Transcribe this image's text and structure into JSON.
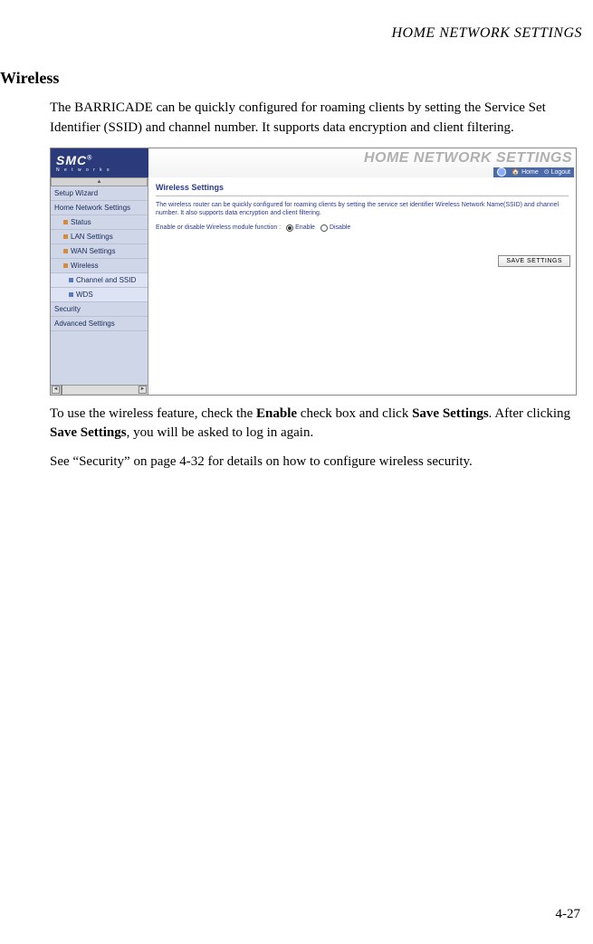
{
  "header": "HOME NETWORK SETTINGS",
  "section_title": "Wireless",
  "intro_text": "The BARRICADE can be quickly configured for roaming clients by setting the Service Set Identifier (SSID) and channel number. It supports data encryption and client filtering.",
  "followup_prefix": "To use the wireless feature, check the ",
  "followup_bold1": "Enable",
  "followup_mid1": " check box and click ",
  "followup_bold2": "Save Settings",
  "followup_mid2": ". After clicking ",
  "followup_bold3": "Save Settings",
  "followup_suffix": ", you will be asked to log in again.",
  "see_text": "See “Security” on page 4-32 for details on how to configure wireless security.",
  "page_number": "4-27",
  "app": {
    "logo_main": "SMC",
    "logo_sub": "N e t w o r k s",
    "title_banner": "HOME NETWORK SETTINGS",
    "topnav_home": "Home",
    "topnav_logout": "Logout",
    "sidebar": {
      "setup_wizard": "Setup Wizard",
      "home_network": "Home Network Settings",
      "status": "Status",
      "lan": "LAN Settings",
      "wan": "WAN Settings",
      "wireless": "Wireless",
      "channel_ssid": "Channel and SSID",
      "wds": "WDS",
      "security": "Security",
      "advanced": "Advanced Settings"
    },
    "panel": {
      "title": "Wireless Settings",
      "desc": "The wireless router can be quickly configured for roaming clients by setting the service set identifier Wireless Network Name(SSID) and channel number. It also supports data encryption and client filtering.",
      "radio_label": "Enable or disable Wireless module function :",
      "opt_enable": "Enable",
      "opt_disable": "Disable",
      "save_button": "SAVE SETTINGS"
    }
  }
}
